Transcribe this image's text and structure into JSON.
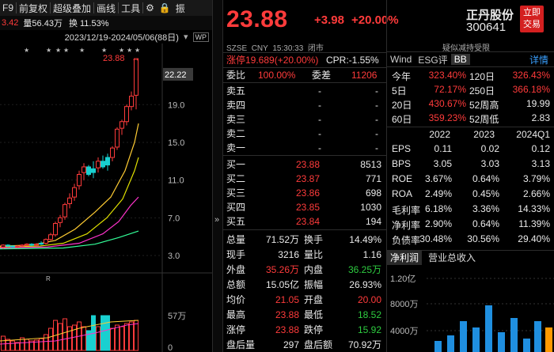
{
  "left_toolbar": {
    "f9": "F9",
    "restore": "前复权",
    "overlay": "超级叠加",
    "draw": "画线",
    "tools": "工具",
    "settings_icon": "gear-icon",
    "lock_icon": "lock-icon",
    "more": "振"
  },
  "left_info": {
    "last": "3.42",
    "volume": "量56.43万",
    "turnover": "换 11.53%",
    "range": "2023/12/19-2024/05/06(88日)"
  },
  "chart": {
    "high_label": "23.88",
    "current_label": "22.22",
    "y_ticks": [
      "19.0",
      "15.0",
      "11.0",
      "7.0",
      "3.0"
    ],
    "vol_ticks": [
      "57万",
      "0"
    ],
    "r_marker": "R",
    "star_marker": "★"
  },
  "quote": {
    "price": "23.88",
    "change": "+3.98",
    "change_pct": "+20.00%",
    "market": "SZSE",
    "currency": "CNY",
    "time": "15:30:33",
    "status": "闭市",
    "limit_up": "涨停19.689(+20.00%)",
    "cpr": "CPR:-1.55%",
    "weibi_label": "委比",
    "weibi": "100.00%",
    "weicha_label": "委差",
    "weicha": "11206",
    "asks": [
      {
        "label": "卖五",
        "price": "-",
        "vol": "-"
      },
      {
        "label": "卖四",
        "price": "-",
        "vol": "-"
      },
      {
        "label": "卖三",
        "price": "-",
        "vol": "-"
      },
      {
        "label": "卖二",
        "price": "-",
        "vol": "-"
      },
      {
        "label": "卖一",
        "price": "-",
        "vol": "-"
      }
    ],
    "bids": [
      {
        "label": "买一",
        "price": "23.88",
        "vol": "8513"
      },
      {
        "label": "买二",
        "price": "23.87",
        "vol": "771"
      },
      {
        "label": "买三",
        "price": "23.86",
        "vol": "698"
      },
      {
        "label": "买四",
        "price": "23.85",
        "vol": "1030"
      },
      {
        "label": "买五",
        "price": "23.84",
        "vol": "194"
      }
    ],
    "stats": [
      {
        "l1": "总量",
        "v1": "71.52万",
        "l2": "换手",
        "v2": "14.49%",
        "c1": "white",
        "c2": "white"
      },
      {
        "l1": "现手",
        "v1": "3216",
        "l2": "量比",
        "v2": "1.16",
        "c1": "white",
        "c2": "white"
      },
      {
        "l1": "外盘",
        "v1": "35.26万",
        "l2": "内盘",
        "v2": "36.25万",
        "c1": "red",
        "c2": "green"
      },
      {
        "l1": "总额",
        "v1": "15.05亿",
        "l2": "振幅",
        "v2": "26.93%",
        "c1": "white",
        "c2": "white"
      },
      {
        "l1": "均价",
        "v1": "21.05",
        "l2": "开盘",
        "v2": "20.00",
        "c1": "red",
        "c2": "red"
      },
      {
        "l1": "最高",
        "v1": "23.88",
        "l2": "最低",
        "v2": "18.52",
        "c1": "red",
        "c2": "green"
      },
      {
        "l1": "涨停",
        "v1": "23.88",
        "l2": "跌停",
        "v2": "15.92",
        "c1": "red",
        "c2": "green"
      },
      {
        "l1": "盘后量",
        "v1": "297",
        "l2": "盘后额",
        "v2": "70.92万",
        "c1": "white",
        "c2": "white"
      }
    ]
  },
  "stock": {
    "name": "正丹股份",
    "code": "300641",
    "trade_btn_1": "立即",
    "trade_btn_2": "交易",
    "hint": "疑似减持受限",
    "tab_wind": "Wind",
    "tab_esg": "ESG评",
    "tab_bb": "BB",
    "tab_detail": "详情"
  },
  "perf": [
    {
      "l1": "今年",
      "v1": "323.40%",
      "l2": "120日",
      "v2": "326.43%",
      "c1": "red",
      "c2": "red"
    },
    {
      "l1": "5日",
      "v1": "72.17%",
      "l2": "250日",
      "v2": "366.18%",
      "c1": "red",
      "c2": "red"
    },
    {
      "l1": "20日",
      "v1": "430.67%",
      "l2": "52周高",
      "v2": "19.99",
      "c1": "red",
      "c2": "white"
    },
    {
      "l1": "60日",
      "v1": "359.23%",
      "l2": "52周低",
      "v2": "2.83",
      "c1": "red",
      "c2": "white"
    }
  ],
  "fin_header": [
    "2022",
    "2023",
    "2024Q1"
  ],
  "fin_rows": [
    {
      "label": "EPS",
      "v": [
        "0.11",
        "0.02",
        "0.12"
      ]
    },
    {
      "label": "BPS",
      "v": [
        "3.05",
        "3.03",
        "3.13"
      ]
    },
    {
      "label": "ROE",
      "v": [
        "3.67%",
        "0.64%",
        "3.79%"
      ]
    },
    {
      "label": "ROA",
      "v": [
        "2.49%",
        "0.45%",
        "2.66%"
      ]
    },
    {
      "label": "毛利率",
      "v": [
        "6.18%",
        "3.36%",
        "14.33%"
      ]
    },
    {
      "label": "净利率",
      "v": [
        "2.90%",
        "0.64%",
        "11.39%"
      ]
    },
    {
      "label": "负债率",
      "v": [
        "30.48%",
        "30.56%",
        "29.40%"
      ]
    }
  ],
  "fin_tabs": {
    "net_profit": "净利润",
    "revenue": "营业总收入"
  },
  "fin_chart": {
    "y_labels": [
      "1.20亿",
      "8000万",
      "4000万"
    ]
  }
}
